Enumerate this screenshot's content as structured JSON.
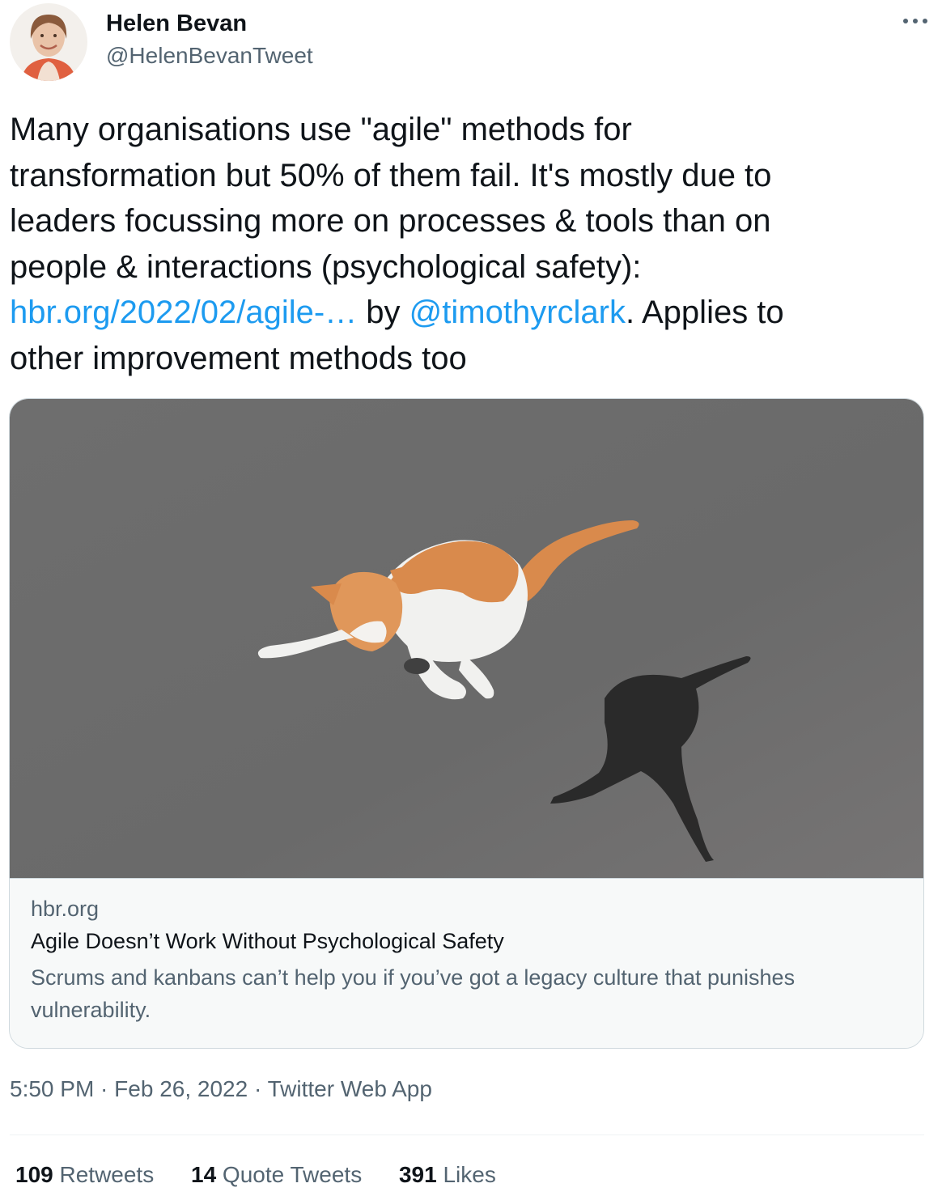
{
  "author": {
    "name": "Helen Bevan",
    "handle": "@HelenBevanTweet",
    "avatar_icon": "profile-photo"
  },
  "more_icon": "more-options-icon",
  "tweet": {
    "line1": "Many organisations use \"agile\" methods for",
    "line2": "transformation but 50% of them fail. It's mostly due to",
    "line3": "leaders focussing more on processes & tools than on",
    "line4": "people & interactions (psychological safety):",
    "link_url": "hbr.org/2022/02/agile-…",
    "text_by": " by ",
    "mention": "@timothyrclark",
    "text_after": ". Applies to",
    "line6": "other improvement methods too"
  },
  "card": {
    "domain": "hbr.org",
    "title": "Agile Doesn’t Work Without Psychological Safety",
    "description": "Scrums and kanbans can’t help you if you’ve got a legacy culture that punishes vulnerability.",
    "image_icon": "kitten-jumping-photo"
  },
  "meta": {
    "time": "5:50 PM",
    "sep1": " · ",
    "date": "Feb 26, 2022",
    "sep2": " · ",
    "source": "Twitter Web App"
  },
  "stats": {
    "retweets_count": "109",
    "retweets_label": " Retweets",
    "quotes_count": "14",
    "quotes_label": " Quote Tweets",
    "likes_count": "391",
    "likes_label": " Likes"
  },
  "colors": {
    "link": "#1d9bf0",
    "text": "#0f1419",
    "secondary": "#536471",
    "border": "#cfd9de",
    "card_bg": "#f7f9f9"
  }
}
